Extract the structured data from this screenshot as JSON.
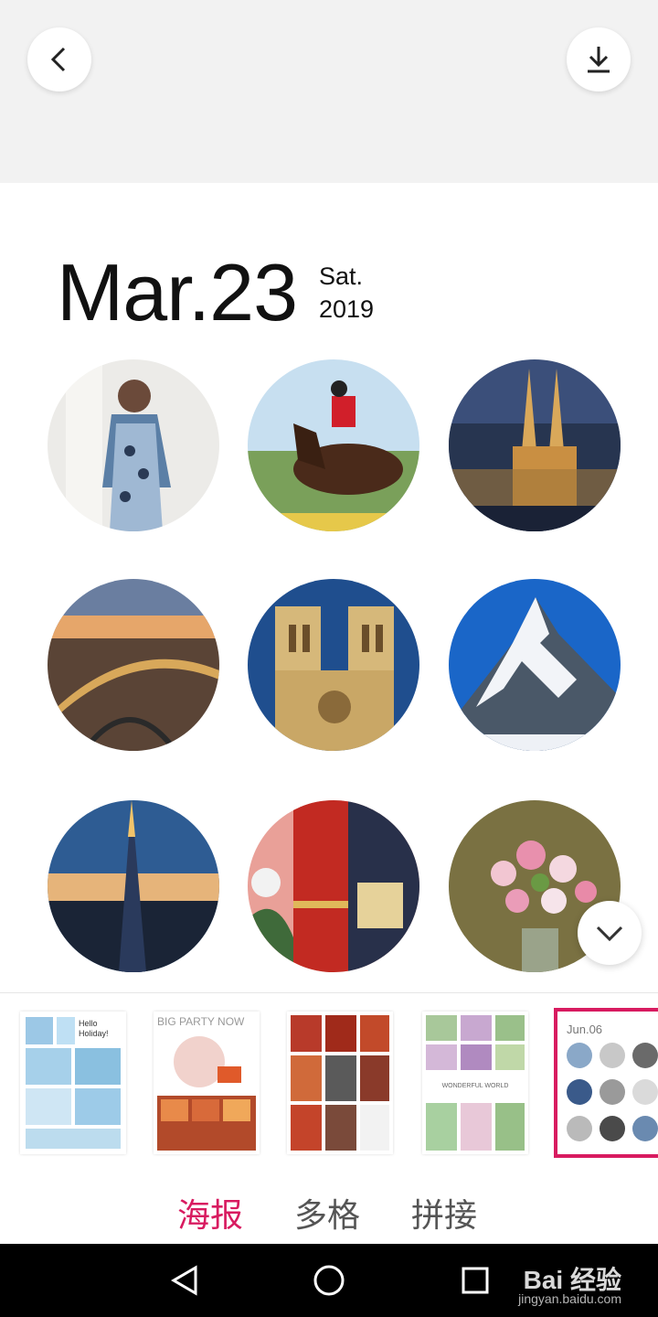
{
  "header": {
    "back_icon": "chevron-left-icon",
    "download_icon": "download-icon"
  },
  "poster": {
    "date_big": "Mar.23",
    "weekday": "Sat.",
    "year": "2019",
    "photos": [
      "woman-portrait",
      "horse-rider",
      "cathedral-night",
      "city-bridge",
      "notre-dame",
      "matterhorn",
      "shard-tower",
      "red-curtain",
      "flowers-vase"
    ]
  },
  "templates": [
    {
      "title": "Hello Holiday!"
    },
    {
      "title": "BIG PARTY NOW"
    },
    {
      "title": ""
    },
    {
      "title": "WONDERFUL WORLD"
    },
    {
      "title": "Jun.06"
    }
  ],
  "tabs": {
    "poster": "海报",
    "grid": "多格",
    "stitch": "拼接"
  },
  "watermark": {
    "brand": "Bai 经验",
    "url": "jingyan.baidu.com"
  },
  "colors": {
    "accent": "#d81b60"
  }
}
